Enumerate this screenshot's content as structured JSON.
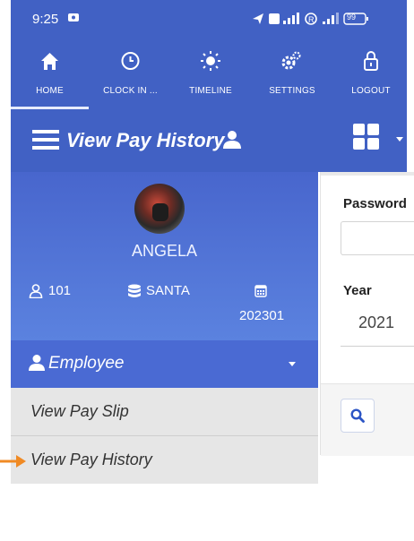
{
  "status_bar": {
    "time": "9:25",
    "battery": "99"
  },
  "nav": {
    "items": [
      {
        "label": "HOME",
        "icon": "home-icon"
      },
      {
        "label": "CLOCK IN ...",
        "icon": "clock-icon"
      },
      {
        "label": "TIMELINE",
        "icon": "timeline-icon"
      },
      {
        "label": "SETTINGS",
        "icon": "gear-icon"
      },
      {
        "label": "LOGOUT",
        "icon": "lock-icon"
      }
    ]
  },
  "header": {
    "title": "View Pay History"
  },
  "profile": {
    "name": "ANGELA",
    "employee_id": "101",
    "store": "SANTA",
    "period": "202301"
  },
  "sidebar": {
    "section_label": "Employee",
    "items": [
      {
        "label": "View Pay Slip"
      },
      {
        "label": "View Pay History"
      }
    ]
  },
  "form": {
    "password_label": "Password",
    "year_label": "Year",
    "year_value": "2021"
  },
  "colors": {
    "primary": "#4161c4",
    "accent_arrow": "#f08a24",
    "sidebar_bg": "#e6e6e6"
  }
}
